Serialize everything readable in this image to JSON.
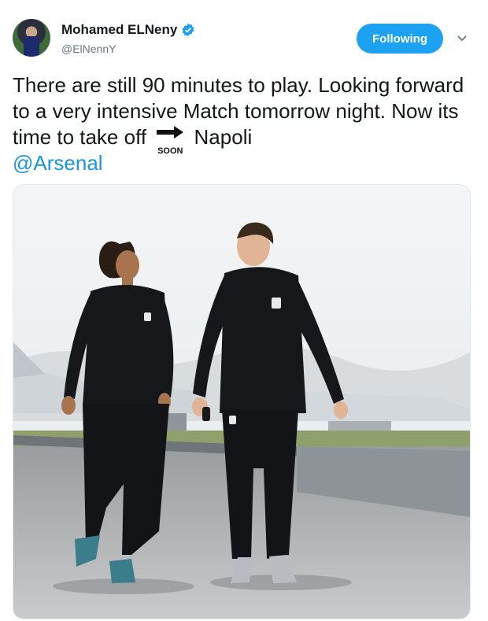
{
  "author": {
    "display_name": "Mohamed ELNeny",
    "handle": "@ElNennY",
    "verified_icon": "verified-badge-icon",
    "avatar_icon": "profile-avatar"
  },
  "follow_button": {
    "label": "Following"
  },
  "menu_icon": "chevron-down-icon",
  "tweet": {
    "text_part1": "There are still 90 minutes to play. Looking forward to a very intensive Match tomorrow night. Now its time to take off",
    "emoji_label": "SOON",
    "emoji_icon": "soon-arrow-emoji",
    "text_part2": "Napoli",
    "mention": "@Arsenal"
  },
  "media": {
    "type": "photo",
    "icon": "tweet-photo"
  },
  "colors": {
    "accent": "#1da1f2",
    "mention": "#1b95e0",
    "handle": "#657786"
  }
}
